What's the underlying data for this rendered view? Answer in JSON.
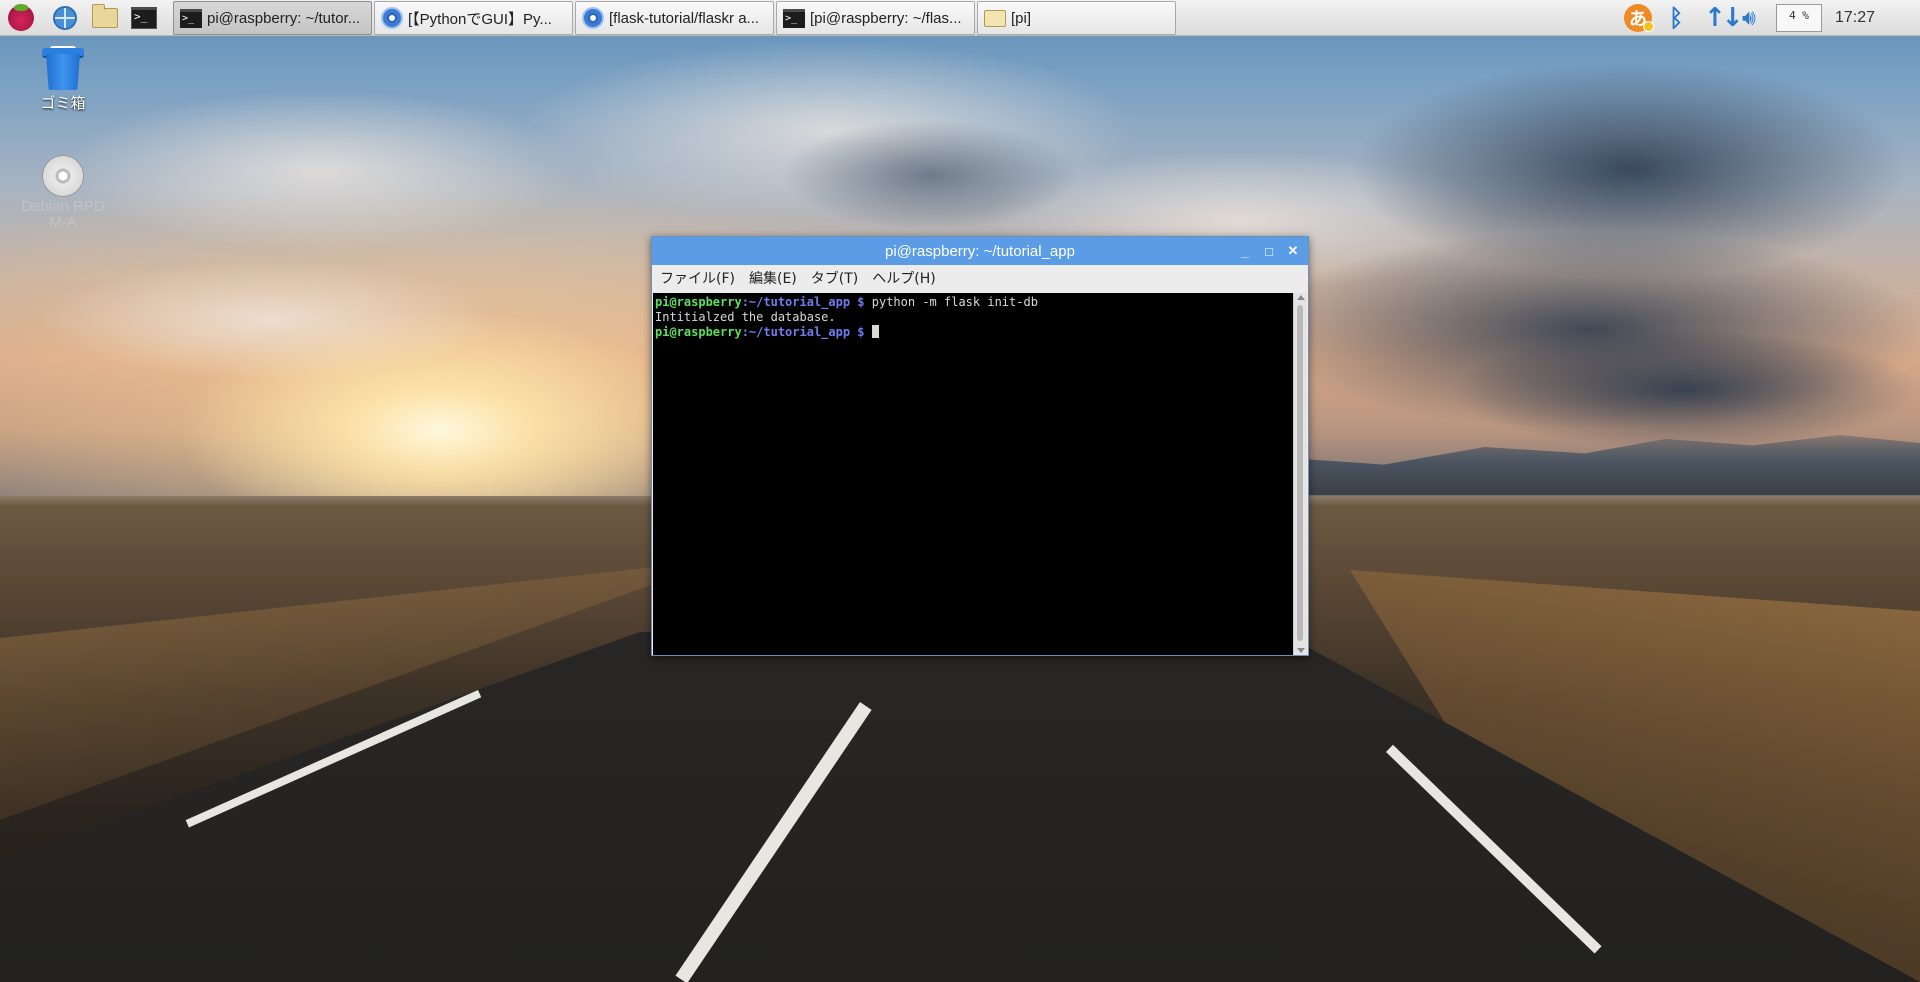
{
  "taskbar": {
    "launchers": [
      {
        "name": "raspberry-menu-icon"
      },
      {
        "name": "web-browser-icon"
      },
      {
        "name": "file-manager-icon"
      },
      {
        "name": "terminal-icon",
        "glyph": ">_"
      }
    ],
    "tasks": [
      {
        "label": "pi@raspberry: ~/tutor...",
        "icon": "terminal-icon",
        "active": true
      },
      {
        "label": "[【PythonでGUI】Py...",
        "icon": "chromium-icon",
        "active": false
      },
      {
        "label": "[flask-tutorial/flaskr a...",
        "icon": "chromium-icon",
        "active": false
      },
      {
        "label": "[pi@raspberry: ~/flas...",
        "icon": "terminal-icon",
        "active": false
      },
      {
        "label": "[pi]",
        "icon": "folder-icon",
        "active": false
      }
    ],
    "tray": {
      "ime_glyph": "あ",
      "cpu_usage": "4 %",
      "clock": "17:27"
    }
  },
  "desktop": {
    "icons": [
      {
        "label": "ゴミ箱",
        "icon": "trash-icon"
      },
      {
        "label": "Debian RPD\nM-A",
        "icon": "cd-icon"
      }
    ]
  },
  "terminal": {
    "title": "pi@raspberry: ~/tutorial_app",
    "menu": [
      "ファイル(F)",
      "編集(E)",
      "タブ(T)",
      "ヘルプ(H)"
    ],
    "lines": [
      {
        "user": "pi@raspberry",
        "path": ":~/tutorial_app $",
        "cmd": " python -m flask init-db"
      },
      {
        "output": "Intitialzed the database."
      },
      {
        "user": "pi@raspberry",
        "path": ":~/tutorial_app $",
        "cmd": " "
      }
    ]
  },
  "colors": {
    "titlebar": "#5b9ce6",
    "prompt_user": "#5ce05c",
    "prompt_path": "#6f7cf0",
    "accent_blue": "#2b78d1"
  }
}
